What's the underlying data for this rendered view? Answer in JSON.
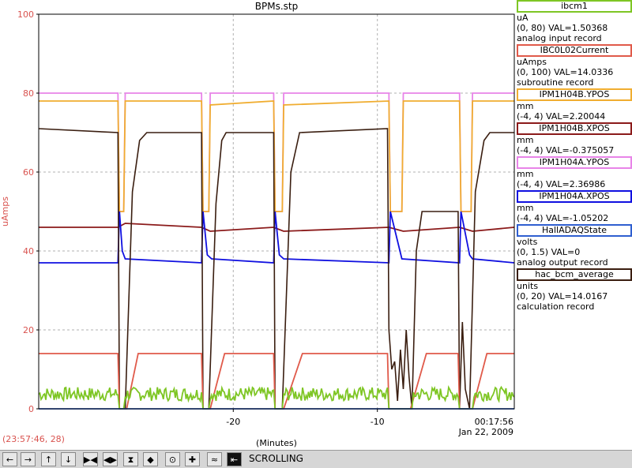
{
  "window_title": "BPMs.stp",
  "cursor_readout": "(23:57:46, 28)",
  "xaxis_label": "(Minutes)",
  "time_readout": {
    "time": "00:17:56",
    "date": "Jan 22, 2009"
  },
  "status": "SCROLLING",
  "legend": [
    {
      "name": "ibcm1",
      "color": "#7ec624",
      "lines": [
        "uA",
        "(0, 80) VAL=1.50368",
        "analog input record"
      ]
    },
    {
      "name": "IBC0L02Current",
      "color": "#e05a4a",
      "lines": [
        "uAmps",
        "(0, 100) VAL=14.0336",
        "subroutine record"
      ]
    },
    {
      "name": "IPM1H04B.YPOS",
      "color": "#f0ad30",
      "lines": [
        "mm",
        "(-4, 4) VAL=2.20044"
      ]
    },
    {
      "name": "IPM1H04B.XPOS",
      "color": "#8b1a1a",
      "lines": [
        "mm",
        "(-4, 4) VAL=-0.375057"
      ]
    },
    {
      "name": "IPM1H04A.YPOS",
      "color": "#e884e8",
      "lines": [
        "mm",
        "(-4, 4) VAL=2.36986"
      ]
    },
    {
      "name": "IPM1H04A.XPOS",
      "color": "#1010e0",
      "lines": [
        "mm",
        "(-4, 4) VAL=-1.05202"
      ]
    },
    {
      "name": "HallADAQState",
      "color": "#2f5fd0",
      "lines": [
        "volts",
        "(0, 1.5)  VAL=0",
        "analog output record"
      ]
    },
    {
      "name": "hac_bcm_average",
      "color": "#3a1e10",
      "lines": [
        "units",
        "(0, 20) VAL=14.0167",
        "calculation record"
      ]
    }
  ],
  "toolbar": {
    "buttons": [
      {
        "name": "scroll-left-button",
        "glyph": "←"
      },
      {
        "name": "scroll-right-button",
        "glyph": "→"
      },
      {
        "name": "scroll-up-button",
        "glyph": "↑"
      },
      {
        "name": "scroll-down-button",
        "glyph": "↓"
      },
      {
        "name": "zoom-in-x-button",
        "glyph": "▶◀"
      },
      {
        "name": "zoom-out-x-button",
        "glyph": "◀▶"
      },
      {
        "name": "zoom-in-y-button",
        "glyph": "⧗"
      },
      {
        "name": "zoom-out-y-button",
        "glyph": "◆"
      },
      {
        "name": "center-button",
        "glyph": "⊙"
      },
      {
        "name": "add-button",
        "glyph": "✚"
      },
      {
        "name": "auto-scale-button",
        "glyph": "≈"
      },
      {
        "name": "scroll-mode-button",
        "glyph": "⇤"
      }
    ]
  },
  "chart_data": {
    "type": "line",
    "ylabel": "uAmps",
    "xlabel": "(Minutes)",
    "xlim": [
      -33.5,
      -0.5
    ],
    "ylim": [
      0,
      100
    ],
    "yticks": [
      0,
      20,
      40,
      60,
      80,
      100
    ],
    "xticks": [
      -20,
      -10
    ],
    "grid": true,
    "legend_placement": "right",
    "series": [
      {
        "name": "IPM1H04A.YPOS",
        "color": "#e884e8",
        "base": 80,
        "segments": [
          [
            -33.5,
            80
          ],
          [
            -28.0,
            80
          ],
          [
            -27.9,
            50
          ],
          [
            -27.6,
            50
          ],
          [
            -27.5,
            80
          ],
          [
            -22.2,
            80
          ],
          [
            -22.1,
            50
          ],
          [
            -21.7,
            50
          ],
          [
            -21.6,
            80
          ],
          [
            -17.2,
            80
          ],
          [
            -17.1,
            50
          ],
          [
            -16.6,
            50
          ],
          [
            -16.5,
            80
          ],
          [
            -9.2,
            80
          ],
          [
            -9.1,
            50
          ],
          [
            -8.3,
            50
          ],
          [
            -8.2,
            80
          ],
          [
            -4.3,
            80
          ],
          [
            -4.2,
            50
          ],
          [
            -3.5,
            50
          ],
          [
            -3.4,
            80
          ],
          [
            -0.5,
            80
          ]
        ]
      },
      {
        "name": "IPM1H04B.YPOS",
        "color": "#f0ad30",
        "segments": [
          [
            -33.5,
            78
          ],
          [
            -28.0,
            78
          ],
          [
            -27.9,
            50
          ],
          [
            -27.6,
            50
          ],
          [
            -27.5,
            78
          ],
          [
            -22.2,
            78
          ],
          [
            -22.1,
            50
          ],
          [
            -21.7,
            50
          ],
          [
            -21.6,
            77
          ],
          [
            -17.2,
            78
          ],
          [
            -17.1,
            50
          ],
          [
            -16.6,
            50
          ],
          [
            -16.5,
            77
          ],
          [
            -9.2,
            78
          ],
          [
            -9.1,
            50
          ],
          [
            -8.3,
            50
          ],
          [
            -8.2,
            78
          ],
          [
            -4.3,
            78
          ],
          [
            -4.2,
            50
          ],
          [
            -3.5,
            50
          ],
          [
            -3.4,
            78
          ],
          [
            -0.5,
            78
          ]
        ]
      },
      {
        "name": "IPM1H04B.XPOS",
        "color": "#8b1a1a",
        "segments": [
          [
            -33.5,
            46
          ],
          [
            -28.0,
            46
          ],
          [
            -27.5,
            47
          ],
          [
            -22.2,
            46
          ],
          [
            -21.6,
            45
          ],
          [
            -17.2,
            46
          ],
          [
            -16.5,
            45
          ],
          [
            -9.2,
            46
          ],
          [
            -8.2,
            45
          ],
          [
            -4.3,
            46
          ],
          [
            -3.4,
            45
          ],
          [
            -0.5,
            46
          ]
        ]
      },
      {
        "name": "IPM1H04A.XPOS",
        "color": "#1010e0",
        "segments": [
          [
            -33.5,
            37
          ],
          [
            -28.0,
            37
          ],
          [
            -27.9,
            50
          ],
          [
            -27.7,
            40
          ],
          [
            -27.5,
            38
          ],
          [
            -22.2,
            37
          ],
          [
            -22.1,
            50
          ],
          [
            -21.8,
            39
          ],
          [
            -21.5,
            38
          ],
          [
            -17.2,
            37
          ],
          [
            -17.1,
            50
          ],
          [
            -16.8,
            39
          ],
          [
            -16.5,
            38
          ],
          [
            -9.2,
            37
          ],
          [
            -9.1,
            50
          ],
          [
            -8.3,
            38
          ],
          [
            -4.3,
            37
          ],
          [
            -4.2,
            50
          ],
          [
            -3.6,
            39
          ],
          [
            -3.4,
            38
          ],
          [
            -0.5,
            37
          ]
        ]
      },
      {
        "name": "hac_bcm_average",
        "color": "#3a1e10",
        "segments": [
          [
            -33.5,
            71
          ],
          [
            -28.0,
            70
          ],
          [
            -27.9,
            0
          ],
          [
            -27.5,
            0
          ],
          [
            -27.0,
            55
          ],
          [
            -26.5,
            68
          ],
          [
            -26.0,
            70
          ],
          [
            -22.2,
            70
          ],
          [
            -22.1,
            0
          ],
          [
            -21.7,
            0
          ],
          [
            -21.2,
            52
          ],
          [
            -20.8,
            68
          ],
          [
            -20.5,
            70
          ],
          [
            -17.2,
            70
          ],
          [
            -17.1,
            0
          ],
          [
            -16.6,
            0
          ],
          [
            -16.0,
            60
          ],
          [
            -15.4,
            70
          ],
          [
            -9.3,
            71
          ],
          [
            -9.2,
            20
          ],
          [
            -9.0,
            10
          ],
          [
            -8.8,
            12
          ],
          [
            -8.6,
            2
          ],
          [
            -8.4,
            15
          ],
          [
            -8.2,
            5
          ],
          [
            -8.0,
            20
          ],
          [
            -7.8,
            8
          ],
          [
            -7.6,
            0
          ],
          [
            -7.3,
            40
          ],
          [
            -6.9,
            50
          ],
          [
            -4.4,
            50
          ],
          [
            -4.3,
            0
          ],
          [
            -4.1,
            22
          ],
          [
            -3.9,
            5
          ],
          [
            -3.6,
            0
          ],
          [
            -3.2,
            55
          ],
          [
            -2.6,
            68
          ],
          [
            -2.2,
            70
          ],
          [
            -0.5,
            70
          ]
        ]
      },
      {
        "name": "IBC0L02Current",
        "color": "#e05a4a",
        "segments": [
          [
            -33.5,
            14
          ],
          [
            -28.0,
            14
          ],
          [
            -27.9,
            0
          ],
          [
            -27.4,
            0
          ],
          [
            -26.6,
            14
          ],
          [
            -22.2,
            14
          ],
          [
            -22.1,
            0
          ],
          [
            -21.6,
            0
          ],
          [
            -20.6,
            14
          ],
          [
            -17.2,
            14
          ],
          [
            -17.1,
            0
          ],
          [
            -16.5,
            0
          ],
          [
            -15.2,
            14
          ],
          [
            -9.3,
            14
          ],
          [
            -9.2,
            0
          ],
          [
            -7.7,
            0
          ],
          [
            -6.6,
            14
          ],
          [
            -4.4,
            14
          ],
          [
            -4.3,
            0
          ],
          [
            -3.4,
            0
          ],
          [
            -2.4,
            14
          ],
          [
            -0.5,
            14
          ]
        ]
      },
      {
        "name": "ibcm1",
        "color": "#7ec624",
        "noise": [
          2,
          3.5
        ],
        "segments": [
          [
            -33.5,
            4
          ],
          [
            -28.0,
            4
          ],
          [
            -27.9,
            0
          ],
          [
            -27.6,
            0
          ],
          [
            -27.5,
            4
          ],
          [
            -22.2,
            4
          ],
          [
            -22.1,
            0
          ],
          [
            -21.7,
            0
          ],
          [
            -21.6,
            3
          ],
          [
            -17.2,
            4
          ],
          [
            -17.1,
            0
          ],
          [
            -16.6,
            0
          ],
          [
            -16.5,
            3
          ],
          [
            -9.3,
            4
          ],
          [
            -9.2,
            0
          ],
          [
            -7.6,
            0
          ],
          [
            -7.5,
            3
          ],
          [
            -4.4,
            3
          ],
          [
            -4.3,
            0
          ],
          [
            -3.4,
            0
          ],
          [
            -3.3,
            3
          ],
          [
            -0.5,
            3
          ]
        ]
      },
      {
        "name": "HallADAQState",
        "color": "#2f5fd0",
        "segments": [
          [
            -33.5,
            0
          ],
          [
            -0.5,
            0
          ]
        ]
      }
    ]
  }
}
